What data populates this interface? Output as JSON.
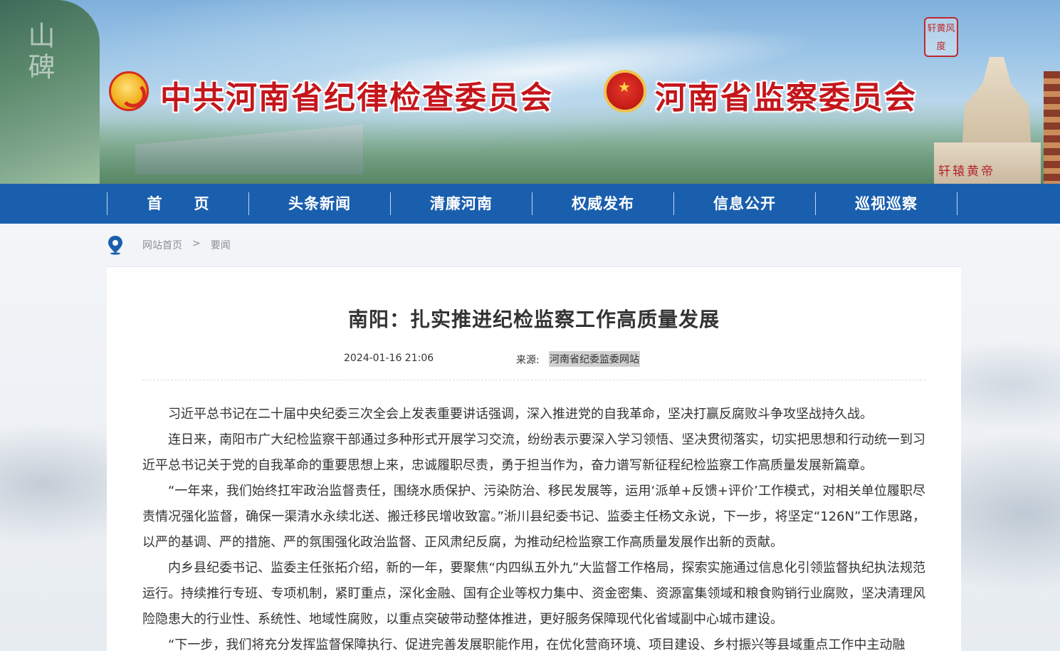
{
  "header": {
    "title_left": "中共河南省纪律检查委员会",
    "title_right": "河南省监察委员会",
    "cliff_text": "山碑",
    "seal_text": [
      "轩",
      "黄",
      "风",
      "度"
    ],
    "statue_label": "轩辕黄帝"
  },
  "nav": {
    "items": [
      "首　页",
      "头条新闻",
      "清廉河南",
      "权威发布",
      "信息公开",
      "巡视巡察"
    ]
  },
  "breadcrumb": {
    "home": "网站首页",
    "separator": ">",
    "current": "要闻"
  },
  "article": {
    "title": "南阳：扎实推进纪检监察工作高质量发展",
    "date": "2024-01-16 21:06",
    "source_label": "来源:",
    "source": "河南省纪委监委网站",
    "paragraphs": [
      "习近平总书记在二十届中央纪委三次全会上发表重要讲话强调，深入推进党的自我革命，坚决打赢反腐败斗争攻坚战持久战。",
      "连日来，南阳市广大纪检监察干部通过多种形式开展学习交流，纷纷表示要深入学习领悟、坚决贯彻落实，切实把思想和行动统一到习近平总书记关于党的自我革命的重要思想上来，忠诚履职尽责，勇于担当作为，奋力谱写新征程纪检监察工作高质量发展新篇章。",
      "“一年来，我们始终扛牢政治监督责任，围绕水质保护、污染防治、移民发展等，运用‘派单+反馈+评价’工作模式，对相关单位履职尽责情况强化监督，确保一渠清水永续北送、搬迁移民增收致富。”淅川县纪委书记、监委主任杨文永说，下一步，将坚定“126N”工作思路，以严的基调、严的措施、严的氛围强化政治监督、正风肃纪反腐，为推动纪检监察工作高质量发展作出新的贡献。",
      "内乡县纪委书记、监委主任张拓介绍，新的一年，要聚焦“内四纵五外九”大监督工作格局，探索实施通过信息化引领监督执纪执法规范运行。持续推行专班、专项机制，紧盯重点，深化金融、国有企业等权力集中、资金密集、资源富集领域和粮食购销行业腐败，坚决清理风险隐患大的行业性、系统性、地域性腐败，以重点突破带动整体推进，更好服务保障现代化省域副中心城市建设。",
      "“下一步，我们将充分发挥监督保障执行、促进完善发展职能作用，在优化营商环境、项目建设、乡村振兴等县域重点工作中主动融"
    ]
  },
  "colors": {
    "nav_bg": "#1a5fae",
    "title_red": "#c4161c",
    "text": "#333333"
  }
}
